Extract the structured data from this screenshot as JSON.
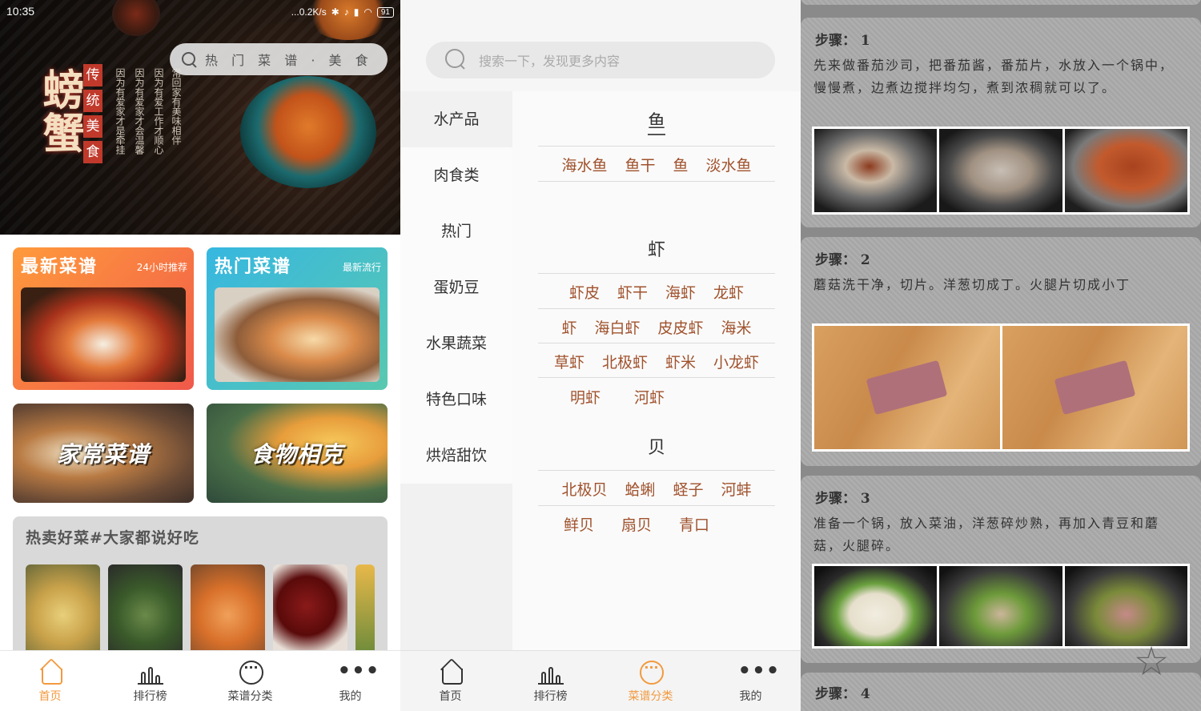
{
  "status": {
    "time": "10:35",
    "speed": "...0.2K/s",
    "battery": "91"
  },
  "home": {
    "banner": {
      "title": "螃蟹",
      "seal": [
        "传",
        "统",
        "美",
        "食"
      ],
      "poem": [
        "因为有爱家才是牵挂",
        "因为有爱家才会温馨",
        "因为有爱工作才顺心",
        "常回家有美味相伴"
      ],
      "search_placeholder": "热 门 菜 谱 · 美 食"
    },
    "cards": {
      "new": {
        "title": "最新菜谱",
        "sub": "24小时推荐"
      },
      "hot": {
        "title": "热门菜谱",
        "sub": "最新流行"
      },
      "home": {
        "title": "家常菜谱"
      },
      "food": {
        "title": "食物相克"
      }
    },
    "hot_sale_title": "热卖好菜#大家都说好吃"
  },
  "tabs": [
    {
      "label": "首页",
      "icon": "home-icon"
    },
    {
      "label": "排行榜",
      "icon": "ranking-icon"
    },
    {
      "label": "菜谱分类",
      "icon": "category-icon"
    },
    {
      "label": "我的",
      "icon": "more-icon"
    }
  ],
  "category": {
    "search_placeholder": "搜索一下，发现更多内容",
    "nav": [
      "水产品",
      "肉食类",
      "热门",
      "蛋奶豆",
      "水果蔬菜",
      "特色口味",
      "烘焙甜饮"
    ],
    "sections": [
      {
        "title": "鱼",
        "rows": [
          [
            "海水鱼",
            "鱼干",
            "鱼",
            "淡水鱼"
          ]
        ]
      },
      {
        "title": "虾",
        "rows": [
          [
            "虾皮",
            "虾干",
            "海虾",
            "龙虾"
          ],
          [
            "虾",
            "海白虾",
            "皮皮虾",
            "海米"
          ],
          [
            "草虾",
            "北极虾",
            "虾米",
            "小龙虾"
          ],
          [
            "明虾",
            "河虾"
          ]
        ]
      },
      {
        "title": "贝",
        "rows": [
          [
            "北极贝",
            "蛤蜊",
            "蛏子",
            "河蚌"
          ],
          [
            "鲜贝",
            "扇贝",
            "青口"
          ]
        ]
      }
    ]
  },
  "steps": [
    {
      "label": "步骤： 1",
      "text": "先来做番茄沙司，把番茄酱，番茄片，水放入一个锅中，慢慢煮，边煮边搅拌均匀，煮到浓稠就可以了。"
    },
    {
      "label": "步骤： 2",
      "text": "蘑菇洗干净，切片。洋葱切成丁。火腿片切成小丁"
    },
    {
      "label": "步骤： 3",
      "text": "准备一个锅，放入菜油，洋葱碎炒熟，再加入青豆和蘑菇，火腿碎。"
    },
    {
      "label": "步骤： 4",
      "text": ""
    }
  ],
  "colors": {
    "accent": "#f29a3f",
    "fish_text": "#a0522d"
  }
}
